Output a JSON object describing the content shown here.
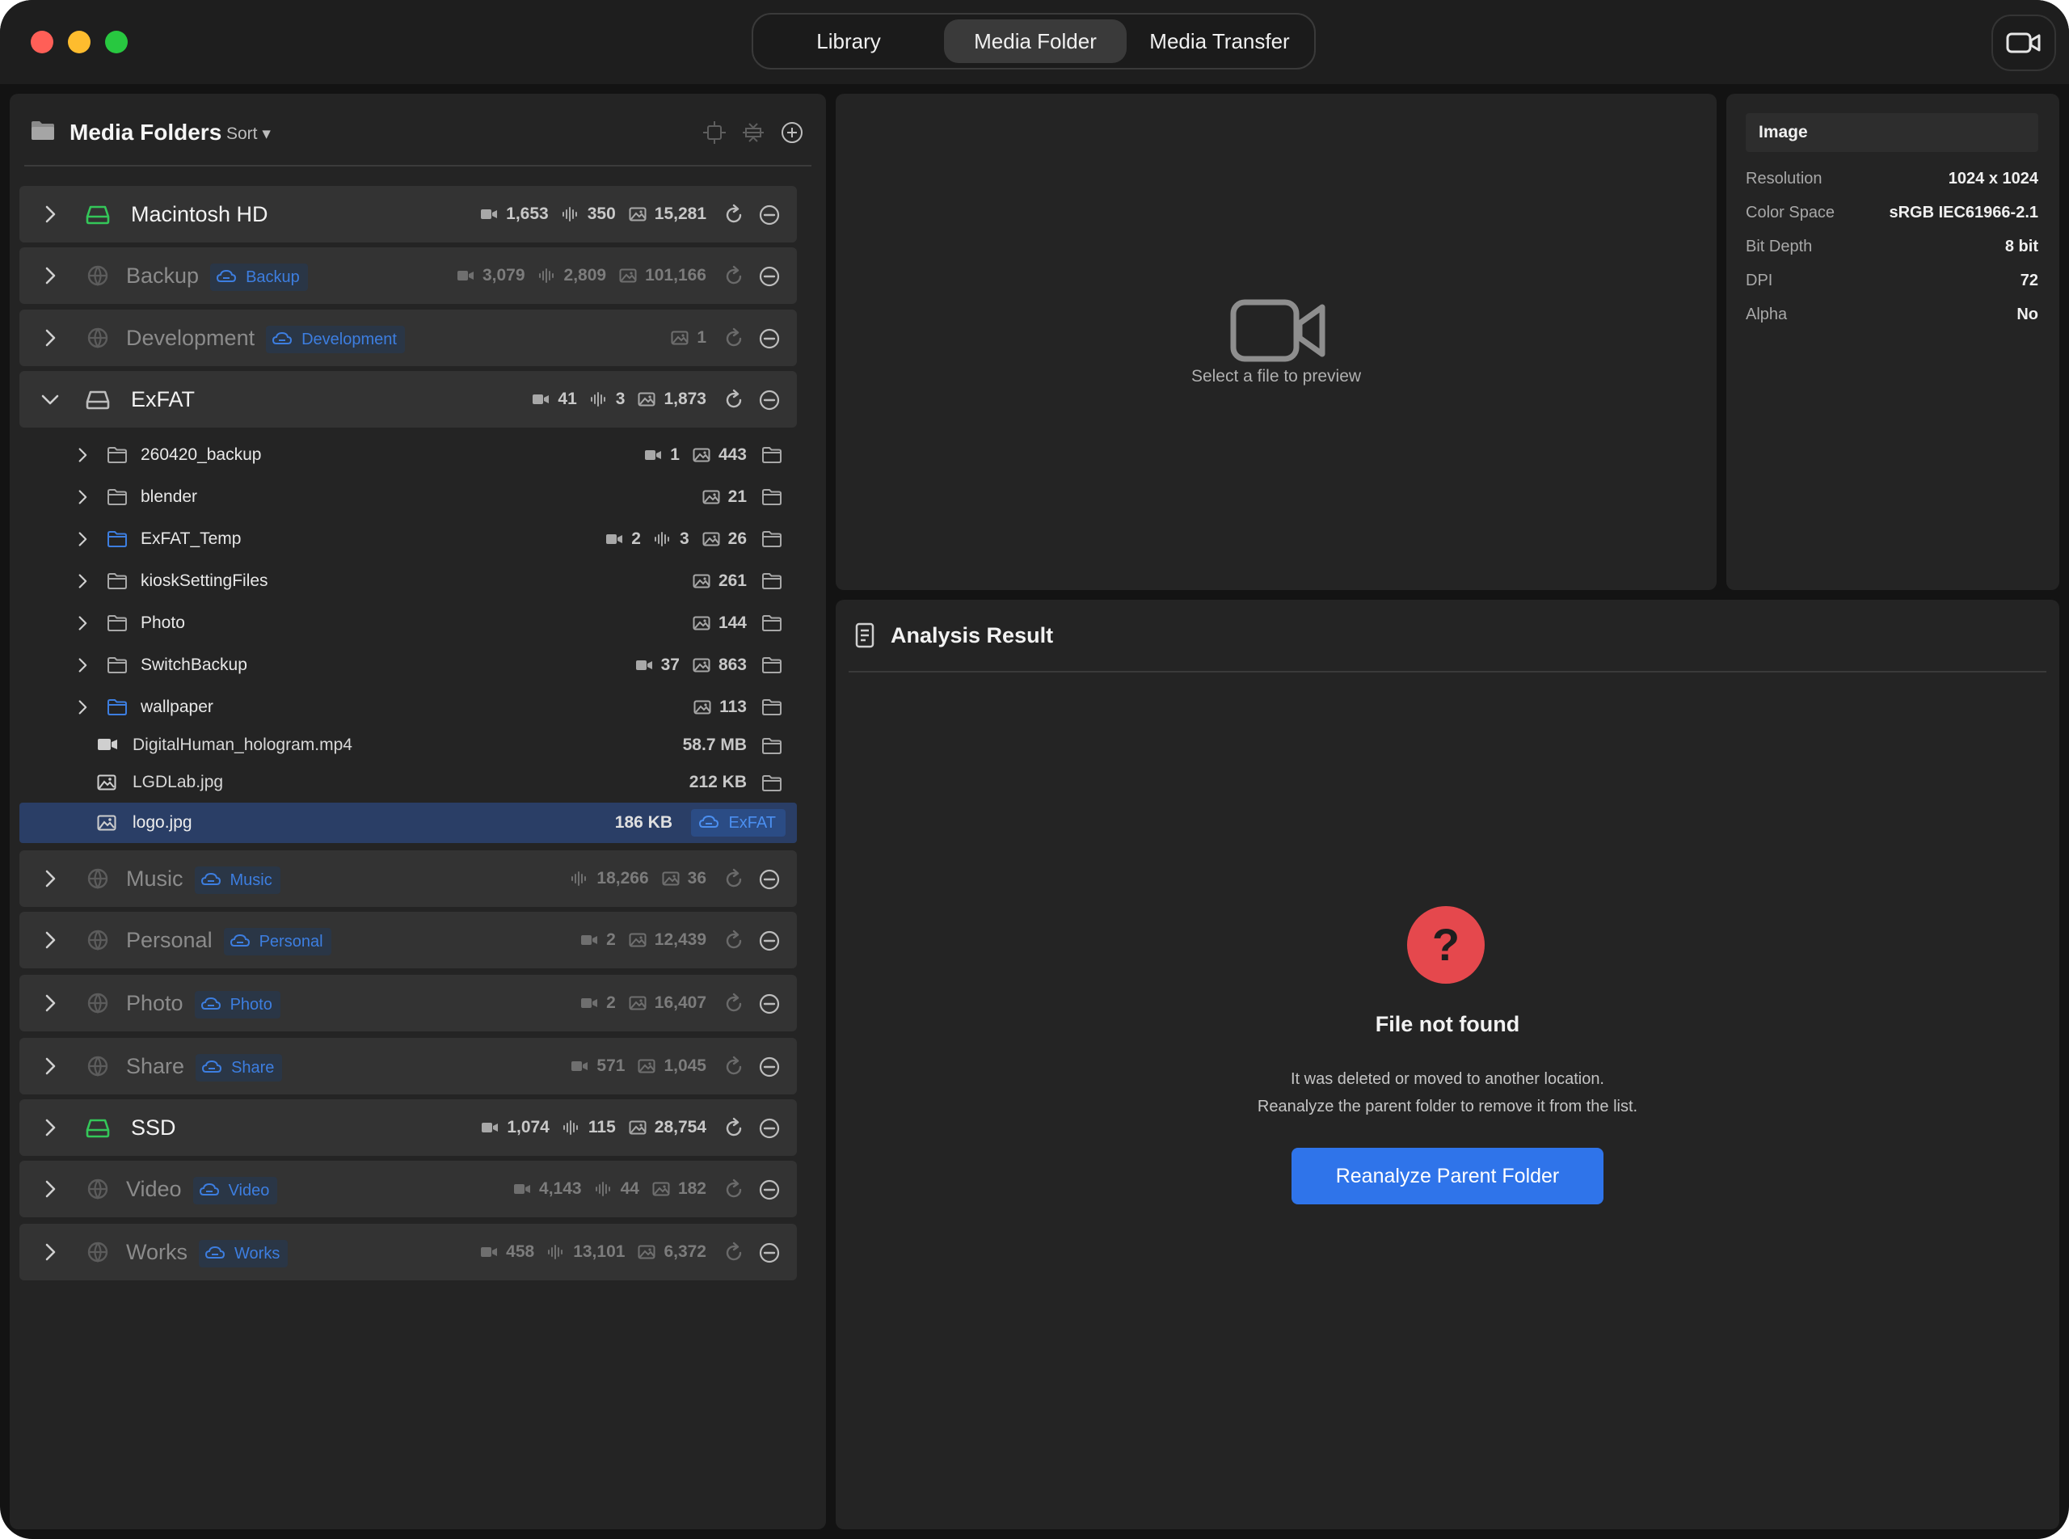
{
  "titlebar": {
    "tabs": [
      {
        "label": "Library",
        "active": false
      },
      {
        "label": "Media Folder",
        "active": true
      },
      {
        "label": "Media Transfer",
        "active": false
      }
    ],
    "camera_icon": "video-camera-icon"
  },
  "sidebar": {
    "title": "Media Folders",
    "sort_label": "Sort ▾",
    "header_icons": [
      "collapse-icon",
      "expand-icon",
      "add-icon"
    ],
    "volumes": [
      {
        "name": "Macintosh HD",
        "kind": "local-drive",
        "dimmed": false,
        "tag": "",
        "video": "1,653",
        "audio": "350",
        "image": "15,281"
      },
      {
        "name": "Backup",
        "kind": "network",
        "dimmed": true,
        "tag": "Backup",
        "video": "3,079",
        "audio": "2,809",
        "image": "101,166"
      },
      {
        "name": "Development",
        "kind": "network",
        "dimmed": true,
        "tag": "Development",
        "video": "",
        "audio": "",
        "image": "1"
      },
      {
        "name": "ExFAT",
        "kind": "external-drive",
        "dimmed": false,
        "expanded": true,
        "tag": "",
        "video": "41",
        "audio": "3",
        "image": "1,873"
      },
      {
        "name": "Music",
        "kind": "network",
        "dimmed": true,
        "tag": "Music",
        "video": "",
        "audio": "18,266",
        "image": "36"
      },
      {
        "name": "Personal",
        "kind": "network",
        "dimmed": true,
        "tag": "Personal",
        "video": "2",
        "audio": "",
        "image": "12,439"
      },
      {
        "name": "Photo",
        "kind": "network",
        "dimmed": true,
        "tag": "Photo",
        "video": "2",
        "audio": "",
        "image": "16,407"
      },
      {
        "name": "Share",
        "kind": "network",
        "dimmed": true,
        "tag": "Share",
        "video": "571",
        "audio": "",
        "image": "1,045"
      },
      {
        "name": "SSD",
        "kind": "local-drive",
        "dimmed": false,
        "tag": "",
        "video": "1,074",
        "audio": "115",
        "image": "28,754"
      },
      {
        "name": "Video",
        "kind": "network",
        "dimmed": true,
        "tag": "Video",
        "video": "4,143",
        "audio": "44",
        "image": "182"
      },
      {
        "name": "Works",
        "kind": "network",
        "dimmed": true,
        "tag": "Works",
        "video": "458",
        "audio": "13,101",
        "image": "6,372"
      }
    ],
    "exfat_folders": [
      {
        "name": "260420_backup",
        "video": "1",
        "audio": "",
        "image": "443",
        "blue": false
      },
      {
        "name": "blender",
        "video": "",
        "audio": "",
        "image": "21",
        "blue": false
      },
      {
        "name": "ExFAT_Temp",
        "video": "2",
        "audio": "3",
        "image": "26",
        "blue": true
      },
      {
        "name": "kioskSettingFiles",
        "video": "",
        "audio": "",
        "image": "261",
        "blue": false
      },
      {
        "name": "Photo",
        "video": "",
        "audio": "",
        "image": "144",
        "blue": false
      },
      {
        "name": "SwitchBackup",
        "video": "37",
        "audio": "",
        "image": "863",
        "blue": false
      },
      {
        "name": "wallpaper",
        "video": "",
        "audio": "",
        "image": "113",
        "blue": true
      }
    ],
    "exfat_files": [
      {
        "name": "DigitalHuman_hologram.mp4",
        "type": "video",
        "size": "58.7 MB"
      },
      {
        "name": "LGDLab.jpg",
        "type": "image",
        "size": "212 KB"
      },
      {
        "name": "logo.jpg",
        "type": "image",
        "size": "186 KB",
        "selected": true,
        "location_tag": "ExFAT"
      }
    ]
  },
  "preview": {
    "placeholder": "Select a file to preview",
    "icon": "video-camera-icon"
  },
  "info": {
    "header": "Image",
    "rows": [
      {
        "key": "Resolution",
        "value": "1024 x 1024"
      },
      {
        "key": "Color Space",
        "value": "sRGB IEC61966-2.1"
      },
      {
        "key": "Bit Depth",
        "value": "8 bit"
      },
      {
        "key": "DPI",
        "value": "72"
      },
      {
        "key": "Alpha",
        "value": "No"
      }
    ]
  },
  "analysis": {
    "title": "Analysis Result",
    "status_icon": "question-mark-icon",
    "error_title": "File not found",
    "error_line1": "It was deleted or moved to another location.",
    "error_line2": "Reanalyze the parent folder to remove it from the list.",
    "button_label": "Reanalyze Parent Folder"
  },
  "colors": {
    "window_bg": "#131313",
    "panel_bg": "#242424",
    "row_bg": "#333333",
    "accent_blue": "#2f74ea",
    "tag_blue": "#3d7ee0",
    "selection_bg": "#2a3e66",
    "error_red": "#e5484d",
    "drive_green": "#34c759"
  }
}
